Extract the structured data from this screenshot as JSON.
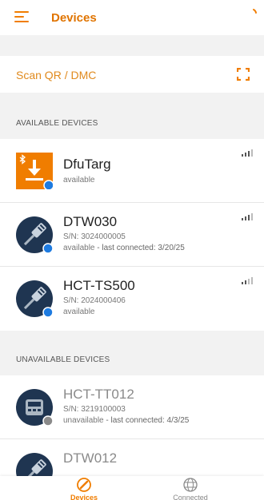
{
  "app": {
    "title": "Devices"
  },
  "colors": {
    "accent": "#f07d00",
    "blue_dot": "#1e7be0",
    "grey_dot": "#8a8a8a",
    "navy": "#1f3551"
  },
  "scan": {
    "label": "Scan QR / DMC"
  },
  "sections": {
    "available": "AVAILABLE DEVICES",
    "unavailable": "UNAVAILABLE DEVICES"
  },
  "available_devices": [
    {
      "name": "DfuTarg",
      "serial": "",
      "status": "available",
      "last_connected": "",
      "icon": "bluetooth-download-icon"
    },
    {
      "name": "DTW030",
      "serial": "S/N: 3024000005",
      "status": "available",
      "last_connected": " - last connected: 3/20/25",
      "icon": "probe-icon"
    },
    {
      "name": "HCT-TS500",
      "serial": "S/N: 2024000406",
      "status": "available",
      "last_connected": "",
      "icon": "probe-icon"
    }
  ],
  "unavailable_devices": [
    {
      "name": "HCT-TT012",
      "serial": "S/N: 3219100003",
      "status": "unavailable",
      "last_connected": " - last connected: 4/3/25",
      "icon": "meter-icon"
    },
    {
      "name": "DTW012",
      "serial": "",
      "status": "",
      "last_connected": "",
      "icon": "probe-icon"
    }
  ],
  "nav": {
    "devices": "Devices",
    "connected": "Connected"
  }
}
